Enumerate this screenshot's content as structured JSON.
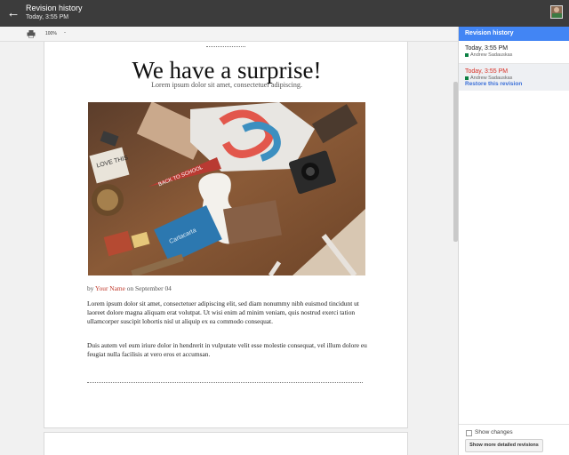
{
  "header": {
    "title": "Revision history",
    "subtitle": "Today, 3:55 PM"
  },
  "toolbar": {
    "print_icon": "print-icon",
    "zoom": "100%",
    "zoom_caret": "-"
  },
  "document": {
    "headline": "We have a surprise!",
    "lead": "Lorem ipsum dolor sit amet, consectetuer adipiscing.",
    "byline_prefix": "by ",
    "author": "Your Name",
    "byline_suffix": " on September 04",
    "paragraph1": "Lorem ipsum dolor sit amet, consectetuer adipiscing elit, sed diam nonummy nibh euismod tincidunt ut laoreet dolore magna aliquam erat volutpat. Ut wisi enim ad minim veniam, quis nostrud exerci tation ullamcorper suscipit lobortis nisl ut aliquip ex ea commodo consequat.",
    "paragraph2": "Duis autem vel eum iriure dolor in hendrerit in vulputate velit esse molestie consequat, vel illum dolore eu feugiat nulla facilisis at vero eros et accumsan.",
    "photo_text": {
      "love_sign": "LOVE THIS",
      "pennant": "BACK TO SCHOOL",
      "book": "Cartacarta"
    }
  },
  "panel": {
    "title": "Revision history",
    "revisions": [
      {
        "time": "Today, 3:55 PM",
        "user": "Andrew Sadauskas"
      },
      {
        "time": "Today, 3:55 PM",
        "user": "Andrew Sadauskas"
      }
    ],
    "restore": "Restore this revision",
    "show_changes": "Show changes",
    "more_button": "Show more detailed revisions"
  },
  "colors": {
    "topbar": "#3c3c3c",
    "accent": "#4285f4",
    "author": "#c0392b",
    "selected_time": "#d93025",
    "user_dot": "#0b8043"
  }
}
